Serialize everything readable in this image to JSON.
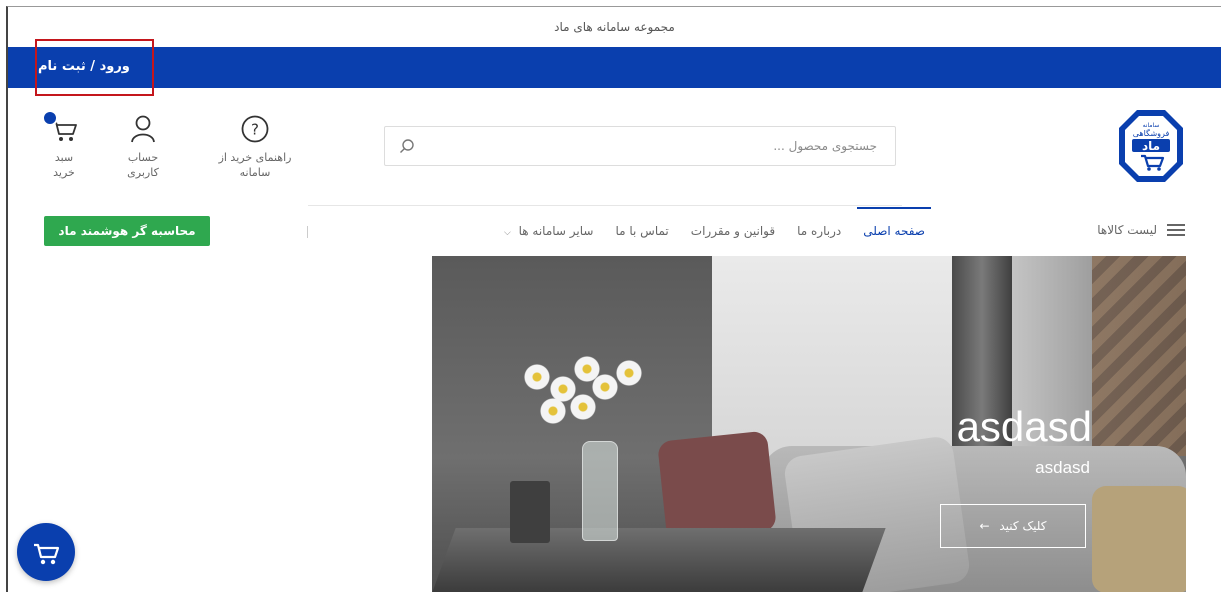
{
  "colors": {
    "brand_blue": "#0a3fae",
    "green": "#2fa84f",
    "highlight_red": "#c4161c"
  },
  "topbar": {
    "title": "مجموعه سامانه های ماد"
  },
  "bluebar": {
    "login_label": "ورود / ثبت نام"
  },
  "header": {
    "logo_text_top": "سامانه",
    "logo_text_mid": "فروشگاهی",
    "logo_text_big": "ماد",
    "search_placeholder": "جستجوی محصول ...",
    "guide_label_1": "راهنمای خرید از",
    "guide_label_2": "سامانه",
    "account_label_1": "حساب",
    "account_label_2": "کاربری",
    "cart_label_1": "سبد",
    "cart_label_2": "خرید"
  },
  "nav": {
    "catalog_label": "لیست کالاها",
    "items": [
      {
        "label": "صفحه اصلی"
      },
      {
        "label": "درباره ما"
      },
      {
        "label": "قوانین و مقررات"
      },
      {
        "label": "تماس با ما"
      },
      {
        "label": "سایر سامانه ها"
      }
    ],
    "calc_button": "محاسبه گر هوشمند ماد"
  },
  "hero": {
    "title": "asdasd",
    "subtitle": "asdasd",
    "button_label": "کلیک کنید",
    "button_arrow": "←"
  },
  "icons": {
    "search": "search-icon",
    "guide": "question-circle-icon",
    "account": "user-icon",
    "cart": "cart-icon",
    "menu": "hamburger-menu-icon",
    "chevron": "chevron-down-icon",
    "float_cart": "cart-icon"
  }
}
